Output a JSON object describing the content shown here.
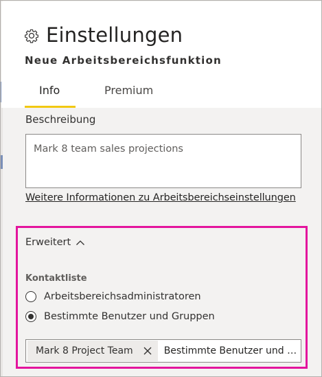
{
  "header": {
    "title": "Einstellungen",
    "subtitle": "Neue Arbeitsbereichsfunktion"
  },
  "tabs": [
    {
      "label": "Info",
      "active": true
    },
    {
      "label": "Premium",
      "active": false
    }
  ],
  "description": {
    "label": "Beschreibung",
    "value": "Mark 8 team sales projections"
  },
  "more_info_link": "Weitere Informationen zu Arbeitsbereichseinstellungen",
  "advanced": {
    "label": "Erweitert",
    "expanded": true,
    "contact_list": {
      "label": "Kontaktliste",
      "options": [
        {
          "label": "Arbeitsbereichsadministratoren",
          "selected": false
        },
        {
          "label": "Bestimmte Benutzer und Gruppen",
          "selected": true
        }
      ]
    },
    "people_picker": {
      "chip_label": "Mark 8 Project Team",
      "input_text": "Bestimmte Benutzer und Gr..."
    }
  },
  "colors": {
    "accent_tab": "#f2c811",
    "highlight_border": "#e3149d"
  },
  "icons": {
    "title": "gear-icon",
    "advanced": "chevron-up-icon",
    "chip_remove": "close-icon"
  }
}
